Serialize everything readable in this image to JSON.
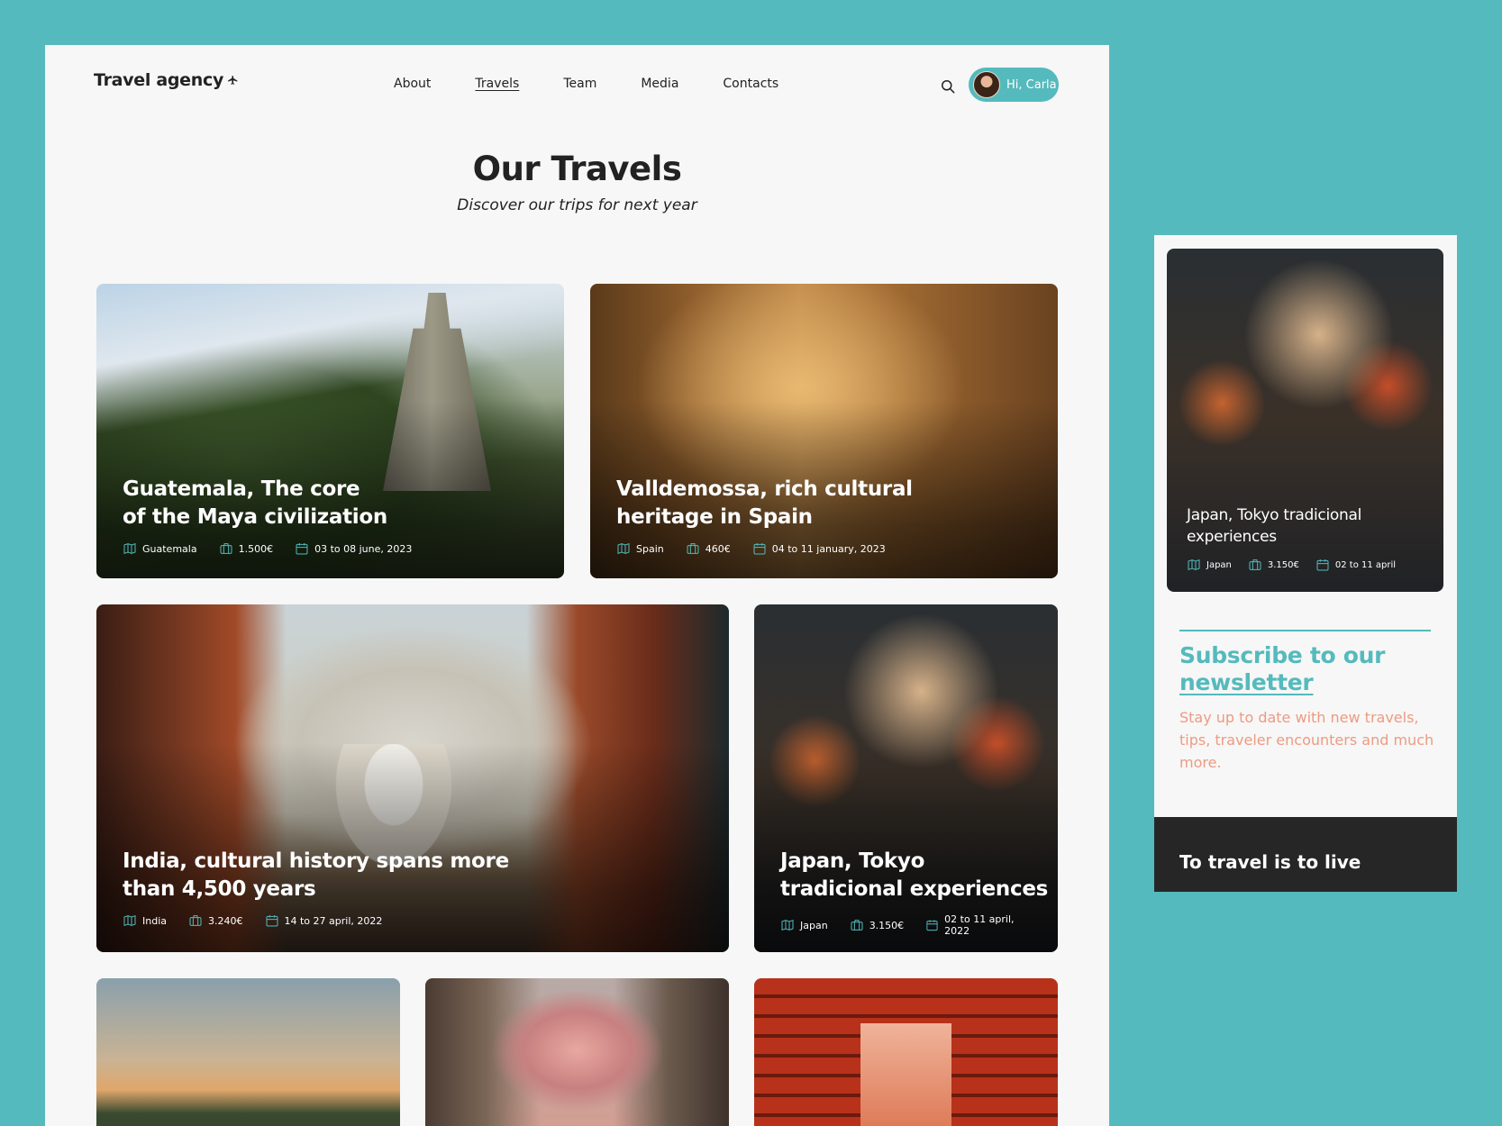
{
  "brand": {
    "name": "Travel agency"
  },
  "nav": {
    "items": [
      {
        "label": "About"
      },
      {
        "label": "Travels"
      },
      {
        "label": "Team"
      },
      {
        "label": "Media"
      },
      {
        "label": "Contacts"
      }
    ],
    "active": "Travels",
    "user_greeting": "Hi, Carla"
  },
  "hero": {
    "title": "Our Travels",
    "subtitle": "Discover our trips for next year"
  },
  "cards": [
    {
      "title": "Guatemala, The core\nof the Maya civilization",
      "country": "Guatemala",
      "price": "1.500€",
      "dates": "03 to 08 june, 2023"
    },
    {
      "title": "Valldemossa, rich cultural\nheritage in Spain",
      "country": "Spain",
      "price": "460€",
      "dates": "04 to 11 january, 2023"
    },
    {
      "title": "India, cultural history spans more\nthan 4,500 years",
      "country": "India",
      "price": "3.240€",
      "dates": "14 to 27 april, 2022"
    },
    {
      "title": "Japan, Tokyo\ntradicional experiences",
      "country": "Japan",
      "price": "3.150€",
      "dates": "02 to 11 april, 2022"
    }
  ],
  "mobile": {
    "card": {
      "title": "Japan, Tokyo tradicional\nexperiences",
      "country": "Japan",
      "price": "3.150€",
      "dates": "02 to 11 april"
    },
    "newsletter": {
      "title_part1": "Subscribe to our",
      "title_part2": "newsletter",
      "text": "Stay up to date with new travels, tips, traveler encounters and much more."
    },
    "footer_text": "To travel is to live"
  },
  "colors": {
    "background": "#54BABD",
    "accent": "#54BABD",
    "newsletter_text": "#EE9A83",
    "footer": "#262626"
  },
  "icons": [
    "plane-icon",
    "search-icon",
    "map-icon",
    "suitcase-icon",
    "calendar-icon"
  ]
}
